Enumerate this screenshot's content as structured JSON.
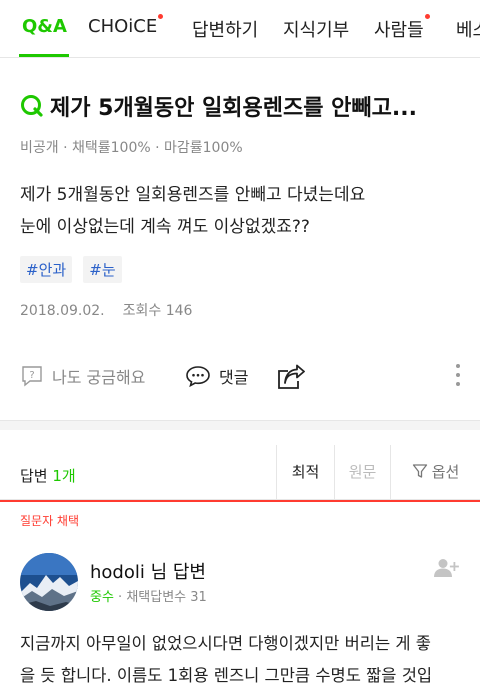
{
  "tabs": [
    {
      "label": "Q&A",
      "active": true
    },
    {
      "label": "CHOiCE",
      "dot": true
    },
    {
      "label": "답변하기"
    },
    {
      "label": "지식기부"
    },
    {
      "label": "사람들",
      "dot": true
    },
    {
      "label": "베스"
    }
  ],
  "question": {
    "title": "제가 5개월동안 일회용렌즈를 안빼고...",
    "meta": "비공개 · 채택률100% · 마감률100%",
    "body_line1": "제가 5개월동안 일회용렌즈를 안빼고 다녔는데요",
    "body_line2": "눈에 이상없는데 계속 껴도 이상없겠죠??",
    "tags": [
      "#안과",
      "#눈"
    ],
    "date": "2018.09.02.",
    "views": "조회수 146"
  },
  "actions": {
    "curious_label": "나도 궁금해요",
    "comment_label": "댓글"
  },
  "answers": {
    "label": "답변",
    "count": "1개",
    "sort_latest": "최적",
    "sort_original": "원문",
    "options": "옵션"
  },
  "chosen_label": "질문자 채택",
  "answer": {
    "name": "hodoli 님 답변",
    "level": "중수",
    "meta_rest": " · 채택답변수 31",
    "line1": "지금까지 아무일이 없었으시다면 다행이겠지만 버리는 게 좋",
    "line2": "을 듯 합니다. 이름도 1회용 렌즈니 그만큼 수명도 짧을 것입"
  },
  "colors": {
    "accent": "#1ec800",
    "chosen": "#ff3b30",
    "tag_text": "#2b61c9"
  }
}
